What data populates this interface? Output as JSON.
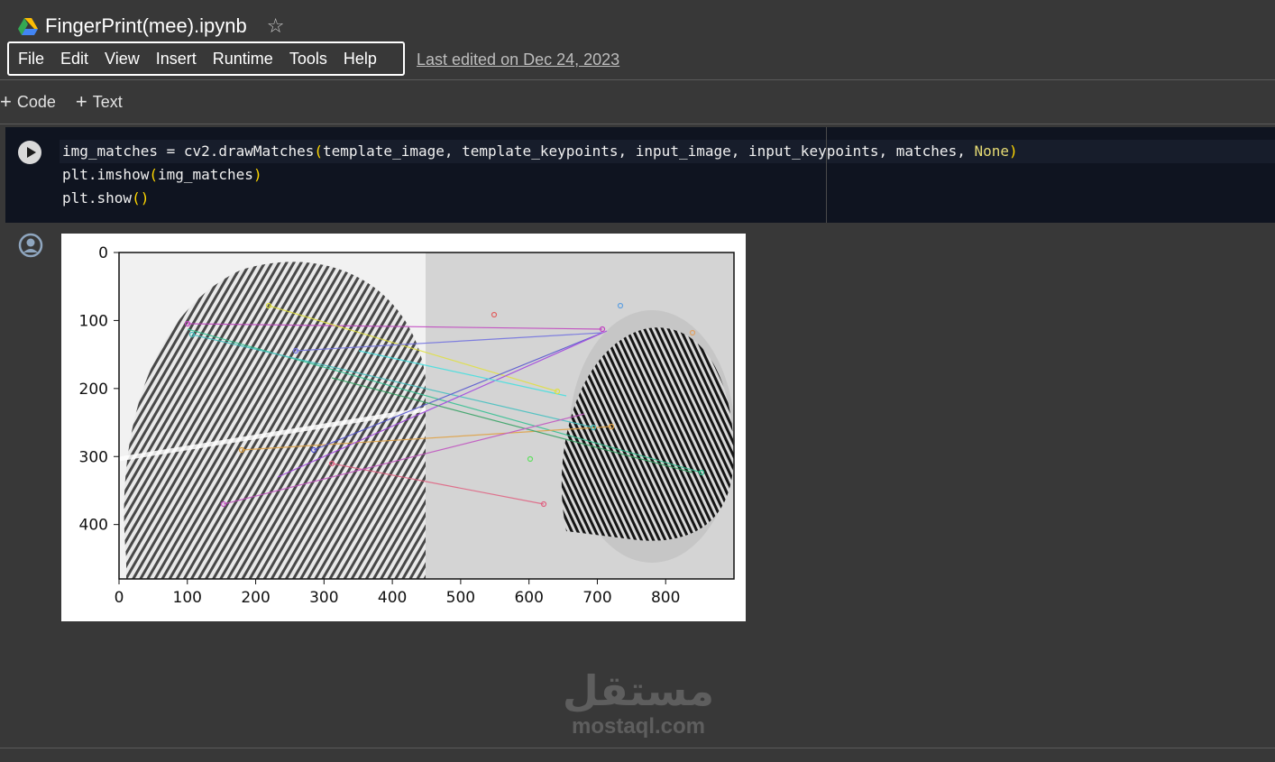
{
  "header": {
    "title": "FingerPrint(mee).ipynb",
    "drive_icon": "google-drive-icon",
    "star_icon": "star-outline-icon",
    "last_edited": "Last edited on Dec 24, 2023"
  },
  "menu": {
    "items": [
      {
        "label": "File"
      },
      {
        "label": "Edit"
      },
      {
        "label": "View"
      },
      {
        "label": "Insert"
      },
      {
        "label": "Runtime"
      },
      {
        "label": "Tools"
      },
      {
        "label": "Help"
      }
    ]
  },
  "toolbar": {
    "add_code_label": "Code",
    "add_text_label": "Text",
    "plus_icon": "plus-icon"
  },
  "cell": {
    "run_icon": "play-icon",
    "line1_prefix": "img_matches = cv2.drawMatches",
    "line1_args": "template_image, template_keypoints, input_image, input_keypoints, matches, ",
    "line1_kw": "None",
    "line2_prefix": "plt.imshow",
    "line2_args": "img_matches",
    "line3_prefix": "plt.show",
    "paren_open": "(",
    "paren_close": ")",
    "paren_pair": "()"
  },
  "output": {
    "icon": "user-circle-icon",
    "content": "fingerprint-match-visualization"
  },
  "chart_data": {
    "type": "image",
    "x_ticks": [
      "0",
      "100",
      "200",
      "300",
      "400",
      "500",
      "600",
      "700",
      "800"
    ],
    "y_ticks": [
      "0",
      "100",
      "200",
      "300",
      "400"
    ],
    "xlim": [
      0,
      900
    ],
    "ylim": [
      480,
      0
    ]
  },
  "watermark": {
    "arabic": "مستقل",
    "latin": "mostaql.com"
  },
  "colors": {
    "background": "#383838",
    "cell_background": "#0f1420",
    "code_keyword": "#e6db74",
    "paren": "#ffd700"
  }
}
